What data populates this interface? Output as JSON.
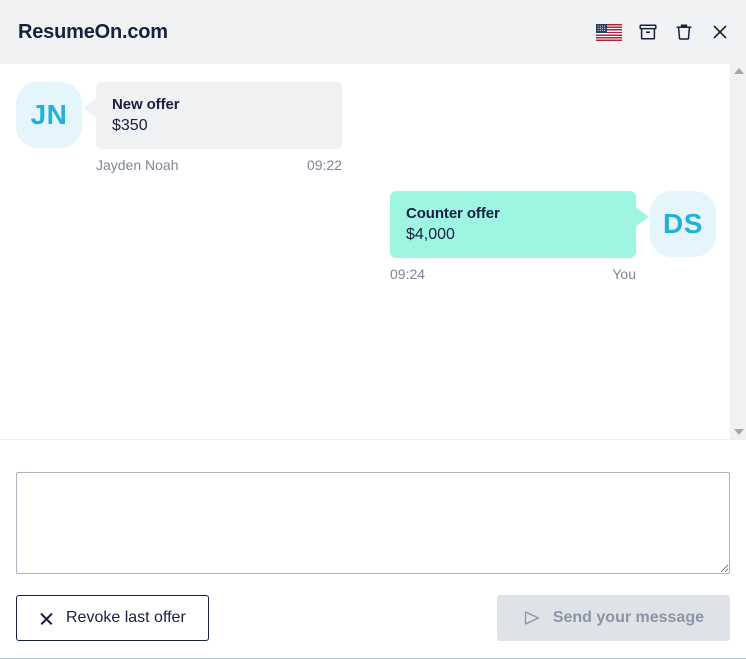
{
  "header": {
    "title": "ResumeOn.com",
    "icons": [
      {
        "name": "flag-us-icon",
        "label": "US"
      },
      {
        "name": "archive-icon",
        "label": "Archive"
      },
      {
        "name": "trash-icon",
        "label": "Delete"
      },
      {
        "name": "close-icon",
        "label": "Close"
      }
    ]
  },
  "chat": {
    "messages": [
      {
        "direction": "incoming",
        "avatar_initials": "JN",
        "title": "New offer",
        "amount": "$350",
        "sender": "Jayden Noah",
        "time": "09:22"
      },
      {
        "direction": "outgoing",
        "avatar_initials": "DS",
        "title": "Counter offer",
        "amount": "$4,000",
        "sender": "You",
        "time": "09:24"
      }
    ],
    "scrollbar": {
      "up_arrow": "scroll-up",
      "down_arrow": "scroll-down"
    }
  },
  "compose": {
    "message_value": "",
    "message_placeholder": ""
  },
  "actions": {
    "revoke_label": "Revoke last offer",
    "send_label": "Send your message"
  },
  "colors": {
    "header_bg": "#f1f2f4",
    "incoming_bubble": "#f0f1f3",
    "outgoing_bubble": "#9ef5e2",
    "avatar_bg": "#e4f6fc",
    "avatar_text": "#23b2d6",
    "meta_text": "#7d8597",
    "primary_text": "#16213e",
    "send_disabled_bg": "#dfe3e8",
    "send_disabled_text": "#8b94a6"
  }
}
